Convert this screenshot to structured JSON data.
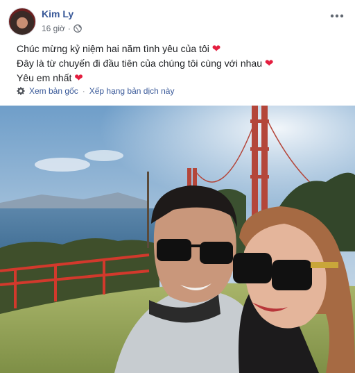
{
  "post": {
    "author_name": "Kim Ly",
    "timestamp": "16 giờ",
    "separator": "·",
    "privacy_icon": "globe-icon",
    "more_icon": "ellipsis-icon",
    "lines": [
      "Chúc mừng kỷ niệm hai năm tình yêu của tôi",
      "Đây là từ chuyến đi đầu tiên của chúng tôi cùng với nhau",
      "Yêu em nhất"
    ],
    "heart": "❤"
  },
  "translation": {
    "icon": "gear-icon",
    "see_original": "Xem bản gốc",
    "separator": "·",
    "rate_translation": "Xếp hạng bản dịch này"
  },
  "colors": {
    "author_link": "#385898",
    "heart": "#e41e3f",
    "meta_text": "#616770"
  }
}
